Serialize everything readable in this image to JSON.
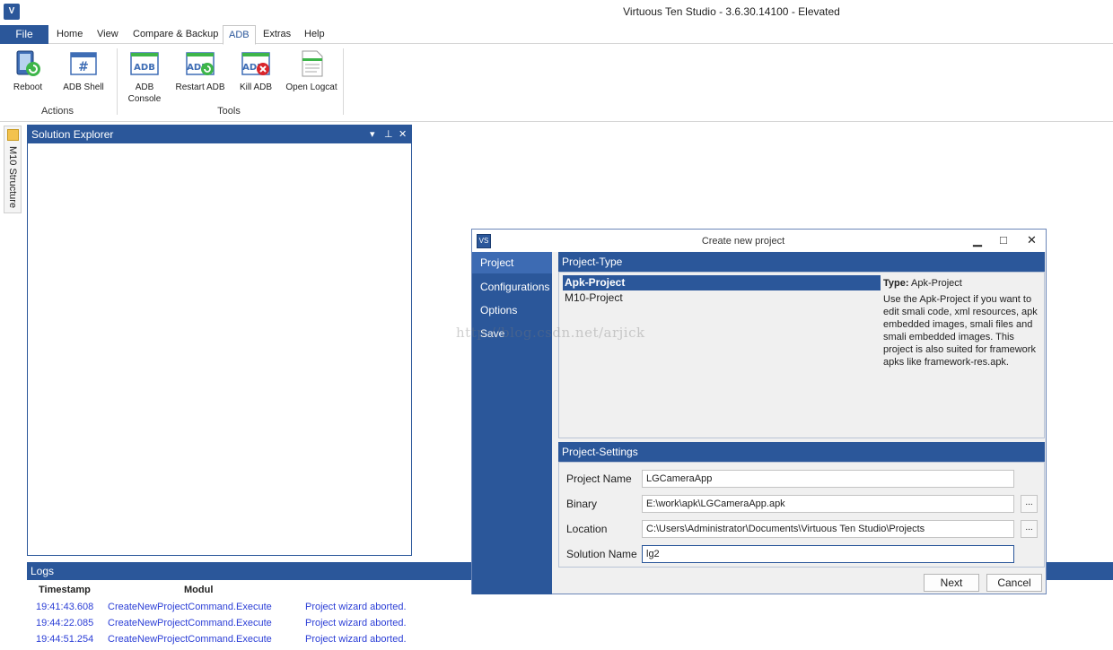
{
  "window": {
    "title": "Virtuous Ten Studio - 3.6.30.14100 - Elevated"
  },
  "menu": {
    "file": "File",
    "tabs": [
      "Home",
      "View",
      "Compare & Backup",
      "ADB",
      "Extras",
      "Help"
    ],
    "active_tab": "ADB"
  },
  "ribbon": {
    "groups": [
      {
        "label": "Actions",
        "buttons": [
          {
            "label": "Reboot"
          },
          {
            "label": "ADB Shell"
          }
        ]
      },
      {
        "label": "Tools",
        "buttons": [
          {
            "label": "ADB Console"
          },
          {
            "label": "Restart ADB"
          },
          {
            "label": "Kill ADB"
          },
          {
            "label": "Open Logcat"
          }
        ]
      }
    ],
    "icon_text": {
      "adb": "ADB",
      "shell": "#"
    }
  },
  "rail": {
    "label": "M10 Structure"
  },
  "explorer": {
    "title": "Solution Explorer"
  },
  "logs": {
    "title": "Logs",
    "columns": [
      "Timestamp",
      "Modul"
    ],
    "rows": [
      {
        "time": "19:41:43.608",
        "modul": "CreateNewProjectCommand.Execute",
        "message": "Project wizard aborted."
      },
      {
        "time": "19:44:22.085",
        "modul": "CreateNewProjectCommand.Execute",
        "message": "Project wizard aborted."
      },
      {
        "time": "19:44:51.254",
        "modul": "CreateNewProjectCommand.Execute",
        "message": "Project wizard aborted."
      }
    ]
  },
  "dialog": {
    "title": "Create new project",
    "nav": [
      "Project",
      "Configurations",
      "Options",
      "Save"
    ],
    "active_nav": "Project",
    "project_type": {
      "header": "Project-Type",
      "items": [
        "Apk-Project",
        "M10-Project"
      ],
      "selected": "Apk-Project",
      "type_label": "Type:",
      "type_value": "Apk-Project",
      "description": "Use the Apk-Project if you want to edit smali code, xml resources, apk embedded images, smali files and smali embedded images. This project is also suited for framework apks like framework-res.apk."
    },
    "project_settings": {
      "header": "Project-Settings",
      "fields": [
        {
          "label": "Project Name",
          "value": "LGCameraApp",
          "browse": false
        },
        {
          "label": "Binary",
          "value": "E:\\work\\apk\\LGCameraApp.apk",
          "browse": true
        },
        {
          "label": "Location",
          "value": "C:\\Users\\Administrator\\Documents\\Virtuous Ten Studio\\Projects",
          "browse": true
        },
        {
          "label": "Solution Name",
          "value": "lg2",
          "browse": false
        }
      ],
      "browse_label": "..."
    },
    "buttons": {
      "next": "Next",
      "cancel": "Cancel"
    }
  },
  "watermark": "http://blog.csdn.net/arjick",
  "colors": {
    "accent": "#2b579a",
    "log_text": "#2b3ed6",
    "green": "#3db54a",
    "red": "#d9252b"
  }
}
